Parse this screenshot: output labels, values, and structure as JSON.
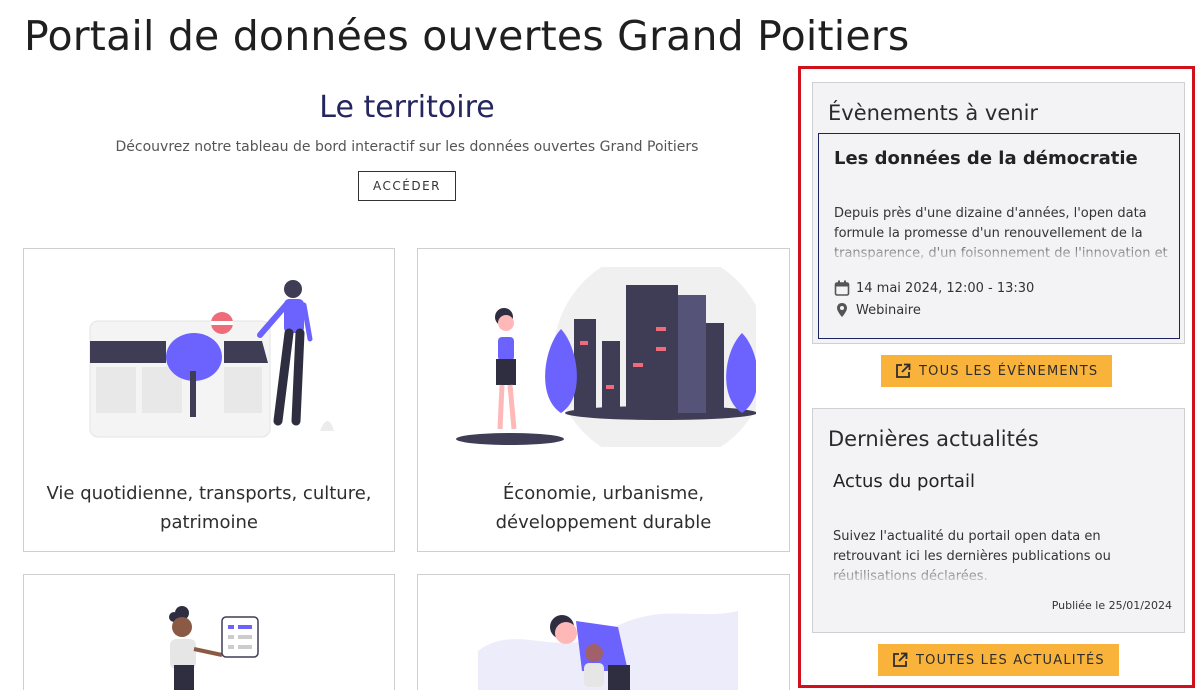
{
  "page": {
    "title": "Portail de données ouvertes Grand Poitiers"
  },
  "territory": {
    "title": "Le territoire",
    "description": "Découvrez notre tableau de bord interactif sur les données ouvertes Grand Poitiers",
    "button_label": "ACCÉDER"
  },
  "cards": [
    {
      "label_line1": "Vie quotidienne, transports, culture,",
      "label_line2": "patrimoine"
    },
    {
      "label_line1": "Économie, urbanisme,",
      "label_line2": "développement durable"
    }
  ],
  "events": {
    "heading": "Évènements à venir",
    "item": {
      "title": "Les données de la démocratie",
      "description": "Depuis près d'une dizaine d'années, l'open data formule la promesse d'un renouvellement de la transparence, d'un foisonnement de l'innovation et",
      "date": "14 mai 2024, 12:00 - 13:30",
      "location": "Webinaire"
    },
    "button_label": "TOUS LES ÉVÈNEMENTS"
  },
  "news": {
    "heading": "Dernières actualités",
    "item": {
      "title": "Actus du portail",
      "description": "Suivez l'actualité du portail open data en retrouvant ici les dernières publications ou réutilisations déclarées.",
      "published": "Publiée le 25/01/2024"
    },
    "button_label": "TOUTES LES ACTUALITÉS"
  },
  "colors": {
    "accent_yellow": "#f9b33b",
    "illustration_purple": "#6c63ff",
    "highlight_border": "#d0101a",
    "dark_navy": "#1d2360"
  },
  "icons": [
    "calendar-icon",
    "location-pin-icon",
    "external-link-icon"
  ]
}
